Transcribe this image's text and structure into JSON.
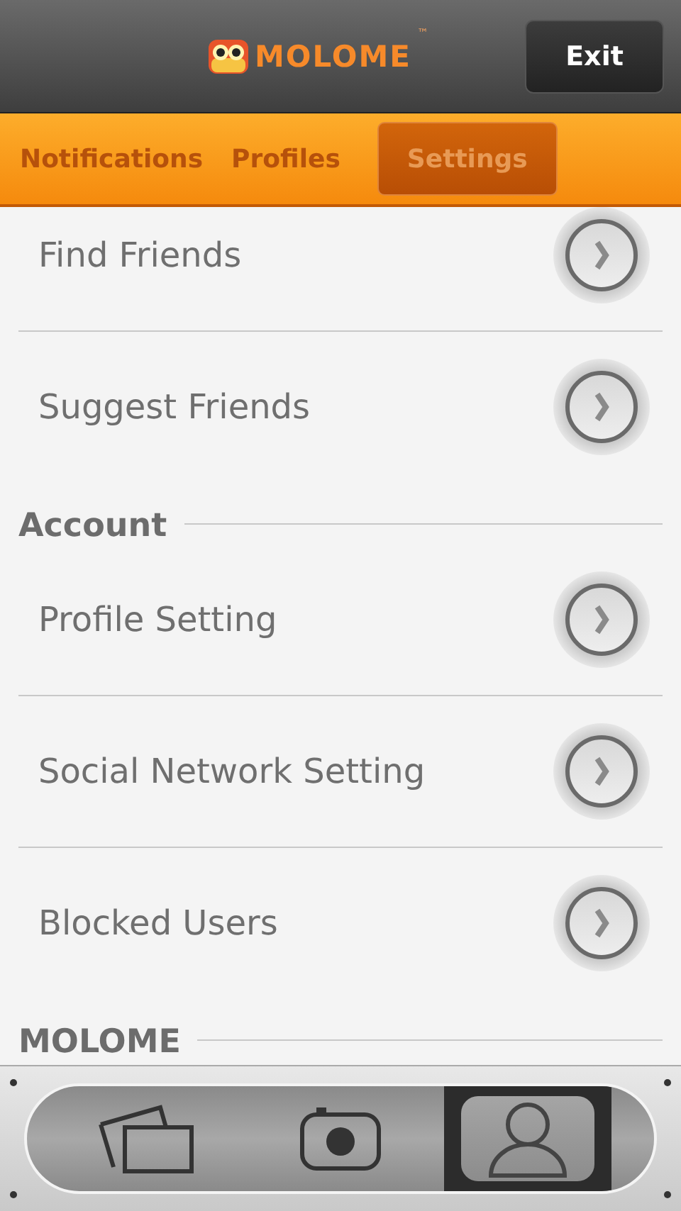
{
  "header": {
    "logo": "MOLOME",
    "trademark": "™",
    "exit_button": "Exit"
  },
  "tabs": [
    {
      "label": "Notifications",
      "selected": false
    },
    {
      "label": "Profiles",
      "selected": false
    },
    {
      "label": "Settings",
      "selected": true
    }
  ],
  "list": [
    {
      "kind": "item",
      "label": "Find Friends"
    },
    {
      "kind": "item",
      "label": "Suggest Friends"
    },
    {
      "kind": "section",
      "label": "Account"
    },
    {
      "kind": "item",
      "label": "Profile Setting"
    },
    {
      "kind": "item",
      "label": "Social Network Setting"
    },
    {
      "kind": "item",
      "label": "Blocked Users"
    },
    {
      "kind": "section",
      "label": "MOLOME"
    }
  ],
  "bottom_tabs": [
    {
      "kind": "photos",
      "selected": false
    },
    {
      "kind": "camera",
      "selected": false
    },
    {
      "kind": "profile",
      "selected": true
    }
  ]
}
